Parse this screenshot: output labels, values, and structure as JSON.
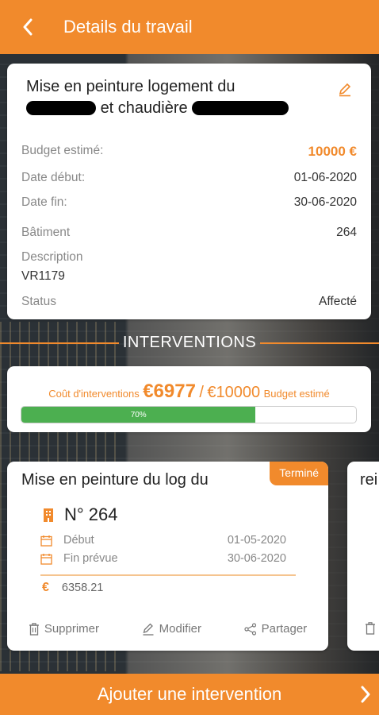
{
  "appbar": {
    "title": "Details du travail",
    "back_icon": "chevron-left-icon"
  },
  "job": {
    "title_line1": "Mise en peinture logement du",
    "title_line2": "et chaudière",
    "budget_label": "Budget estimé:",
    "budget_value": "10000 €",
    "start_label": "Date début:",
    "start_value": "01-06-2020",
    "end_label": "Date fin:",
    "end_value": "30-06-2020",
    "building_label": "Bâtiment",
    "building_value": "264",
    "description_label": "Description",
    "description_value": "VR1179",
    "status_label": "Status",
    "status_value": "Affecté"
  },
  "section": {
    "title": "INTERVENTIONS"
  },
  "cost": {
    "label": "Coût d'interventions",
    "amount": "€6977",
    "separator": "/",
    "budget": "€10000",
    "budget_label": "Budget estimé",
    "progress_text": "70%",
    "progress_fraction": 0.7
  },
  "intervention": {
    "title": "Mise en peinture du log du",
    "badge": "Terminé",
    "number": "N° 264",
    "start_label": "Début",
    "start_value": "01-05-2020",
    "end_label": "Fin prévue",
    "end_value": "30-06-2020",
    "currency": "€",
    "amount": "6358.21",
    "delete_label": "Supprimer",
    "edit_label": "Modifier",
    "share_label": "Partager"
  },
  "intervention_peek": {
    "title": "rei"
  },
  "bottom": {
    "label": "Ajouter une intervention"
  },
  "colors": {
    "accent": "#f18a2c",
    "progress": "#4caf50"
  }
}
